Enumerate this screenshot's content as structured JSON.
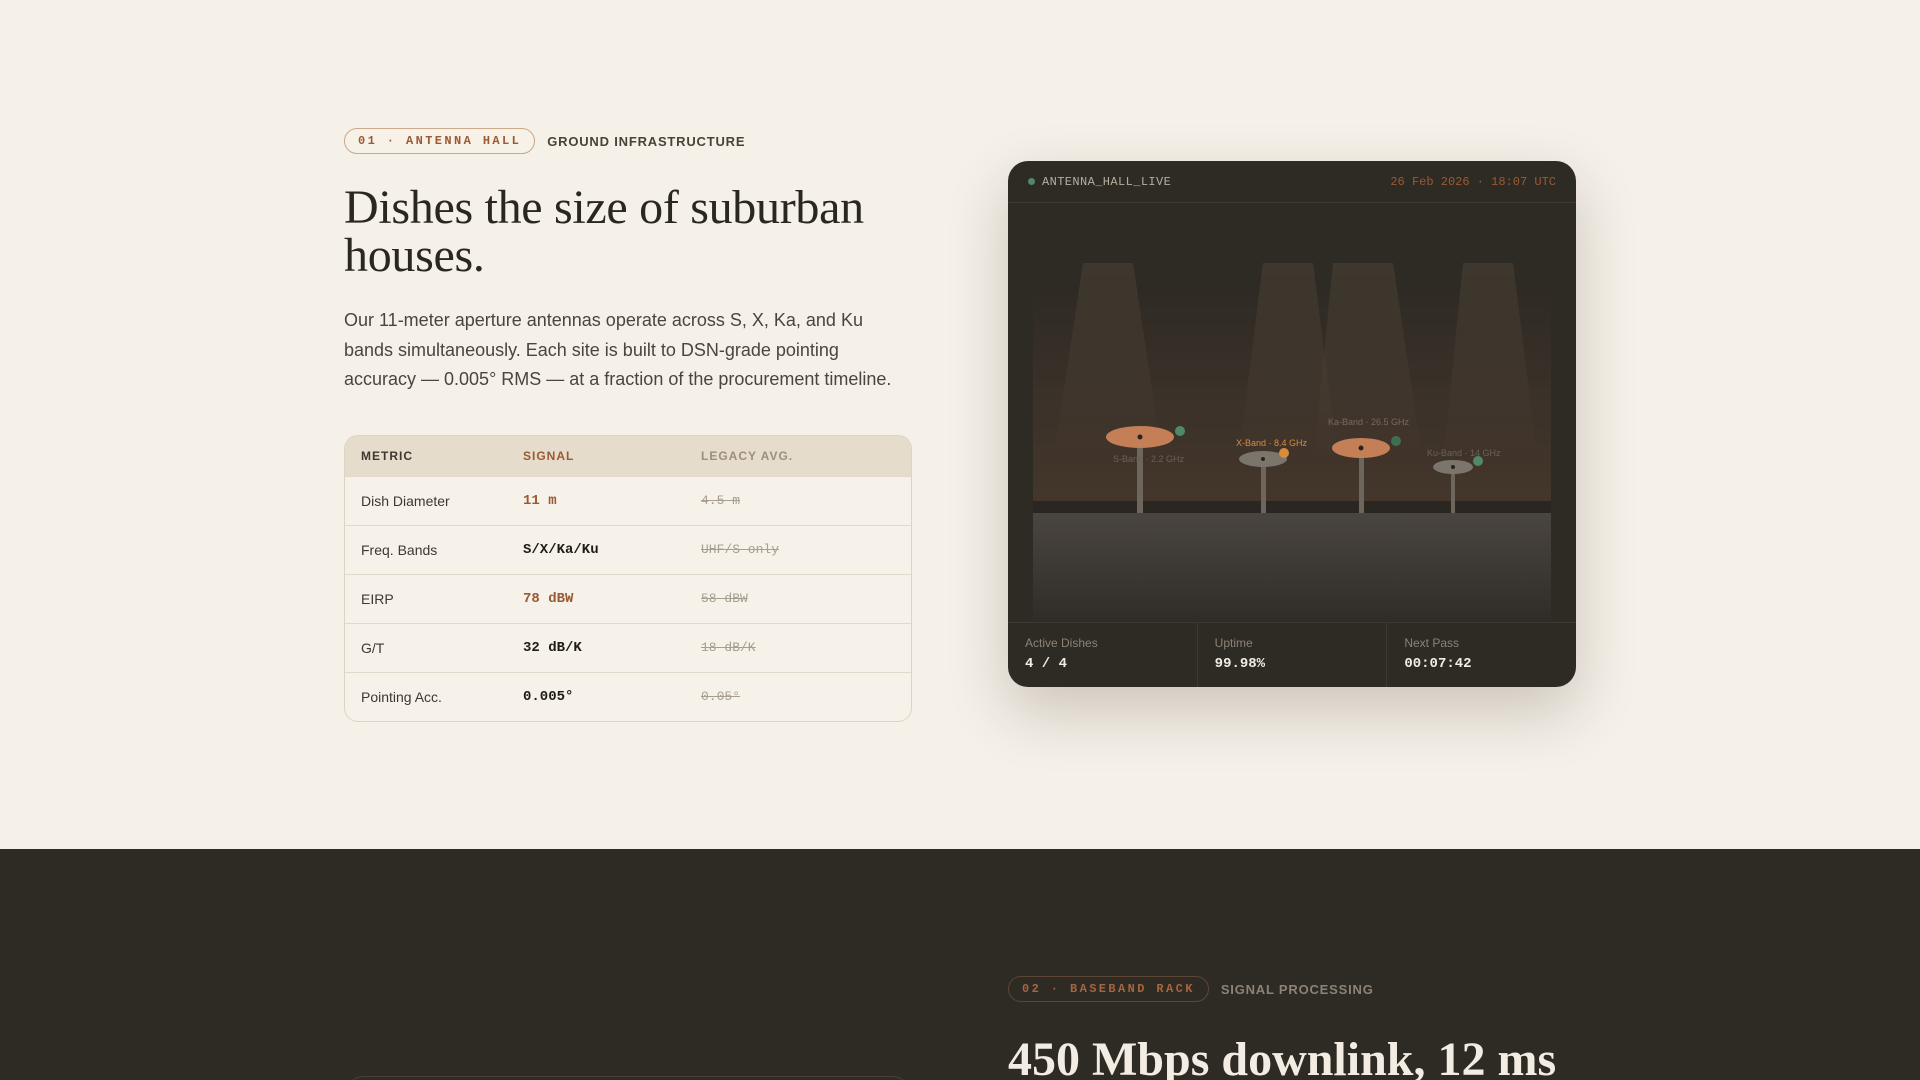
{
  "section1": {
    "eyebrow_tag": "01 · ANTENNA HALL",
    "eyebrow_label": "GROUND INFRASTRUCTURE",
    "headline": "Dishes the size of suburban houses.",
    "body": "Our 11-meter aperture antennas operate across S, X, Ka, and Ku bands simultaneously. Each site is built to DSN-grade pointing accuracy — 0.005° RMS — at a fraction of the procurement timeline.",
    "table": {
      "headers": [
        "METRIC",
        "SIGNAL",
        "LEGACY AVG."
      ],
      "rows": [
        {
          "metric": "Dish Diameter",
          "signal": "11 m",
          "legacy": "4.5 m",
          "accent": true
        },
        {
          "metric": "Freq. Bands",
          "signal": "S/X/Ka/Ku",
          "legacy": "UHF/S only",
          "accent": false
        },
        {
          "metric": "EIRP",
          "signal": "78 dBW",
          "legacy": "58 dBW",
          "accent": true
        },
        {
          "metric": "G/T",
          "signal": "32 dB/K",
          "legacy": "18 dB/K",
          "accent": false
        },
        {
          "metric": "Pointing Acc.",
          "signal": "0.005°",
          "legacy": "0.05°",
          "accent": false
        }
      ]
    }
  },
  "panel": {
    "live_label": "ANTENNA_HALL_LIVE",
    "timestamp": "26 Feb 2026 · 18:07 UTC",
    "bands": [
      {
        "label": "S-Band · 2.2 GHz",
        "status": "green",
        "emphasis": false
      },
      {
        "label": "X-Band · 8.4 GHz",
        "status": "orange",
        "emphasis": true
      },
      {
        "label": "Ka-Band · 26.5 GHz",
        "status": "green",
        "emphasis": false
      },
      {
        "label": "Ku-Band · 14 GHz",
        "status": "green",
        "emphasis": false
      }
    ],
    "stats": [
      {
        "label": "Active Dishes",
        "value": "4 / 4"
      },
      {
        "label": "Uptime",
        "value": "99.98%"
      },
      {
        "label": "Next Pass",
        "value": "00:07:42"
      }
    ]
  },
  "section2": {
    "eyebrow_tag": "02 · BASEBAND RACK",
    "eyebrow_label": "SIGNAL PROCESSING",
    "headline": "450 Mbps downlink, 12 ms"
  },
  "colors": {
    "accent": "#9a5a34",
    "status_green": "#4f8a68",
    "status_orange": "#d98c3c",
    "dark_bg": "#2e2a24",
    "light_bg": "#f5f0e8"
  }
}
